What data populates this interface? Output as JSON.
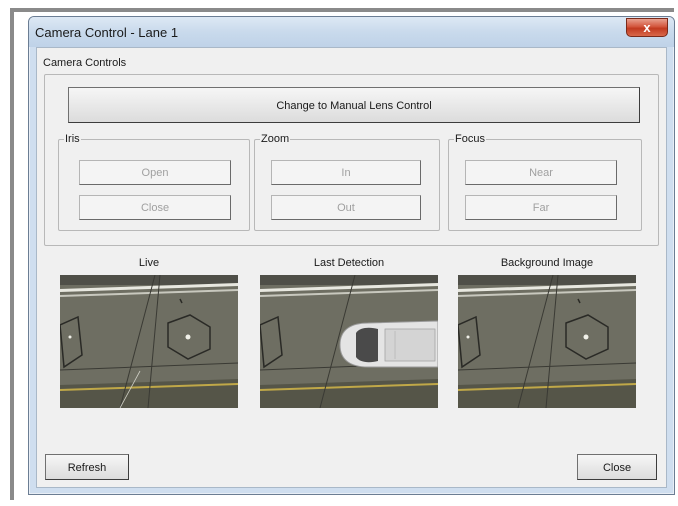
{
  "window": {
    "title": "Camera Control - Lane 1",
    "close_glyph": "x"
  },
  "camera_controls": {
    "label": "Camera Controls",
    "manual_lens_button": "Change to Manual Lens Control",
    "iris": {
      "label": "Iris",
      "open": "Open",
      "close": "Close"
    },
    "zoom": {
      "label": "Zoom",
      "in": "In",
      "out": "Out"
    },
    "focus": {
      "label": "Focus",
      "near": "Near",
      "far": "Far"
    }
  },
  "images": {
    "live_label": "Live",
    "last_detection_label": "Last Detection",
    "background_label": "Background Image"
  },
  "footer": {
    "refresh": "Refresh",
    "close": "Close"
  },
  "colors": {
    "road": "#707064",
    "lane_line_white": "#e8e8e0",
    "lane_line_yellow": "#b8a040",
    "titlebar": "#c9daec",
    "close_button": "#c13a20"
  },
  "icons": {
    "close": "close-icon"
  }
}
